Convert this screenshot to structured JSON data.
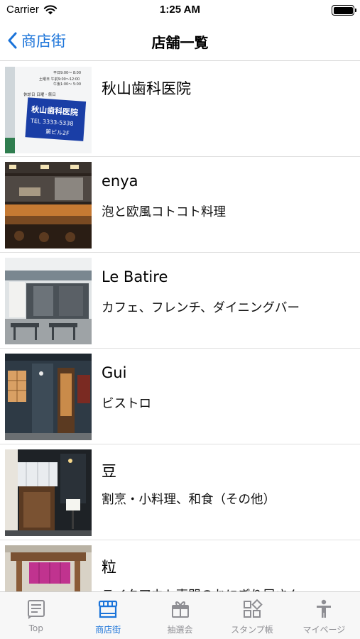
{
  "status_bar": {
    "carrier": "Carrier",
    "time": "1:25 AM"
  },
  "nav": {
    "back_label": "商店街",
    "title": "店舗一覧"
  },
  "shops": [
    {
      "name": "秋山歯科医院",
      "category": ""
    },
    {
      "name": "enya",
      "category": "泡と欧風コトコト料理"
    },
    {
      "name": "Le Batire",
      "category": "カフェ、フレンチ、ダイニングバー"
    },
    {
      "name": "Gui",
      "category": "ビストロ"
    },
    {
      "name": "豆",
      "category": "割烹・小料理、和食（その他）"
    },
    {
      "name": "粒",
      "category": "テイクアウト専門のおにぎり屋さん"
    }
  ],
  "thumb_text": {
    "sign_name": "秋山歯科医院",
    "sign_tel": "TEL 3333-5338",
    "sign_floor": "第ビル2F",
    "hours_1": "平日9:00～ 8:00",
    "hours_2": "土曜日 午前9:00～12:00",
    "hours_3": "午後1:00～ 5:00",
    "closed": "休診日  日曜・祭日"
  },
  "tabs": [
    {
      "label": "Top",
      "icon": "list-icon",
      "active": false
    },
    {
      "label": "商店街",
      "icon": "storefront-icon",
      "active": true
    },
    {
      "label": "抽選会",
      "icon": "ticket-icon",
      "active": false
    },
    {
      "label": "スタンプ帳",
      "icon": "grid-apps-icon",
      "active": false
    },
    {
      "label": "マイページ",
      "icon": "person-icon",
      "active": false
    }
  ],
  "colors": {
    "accent": "#1a73d9",
    "inactive": "#8e8e93",
    "separator": "#e0e0e0"
  }
}
